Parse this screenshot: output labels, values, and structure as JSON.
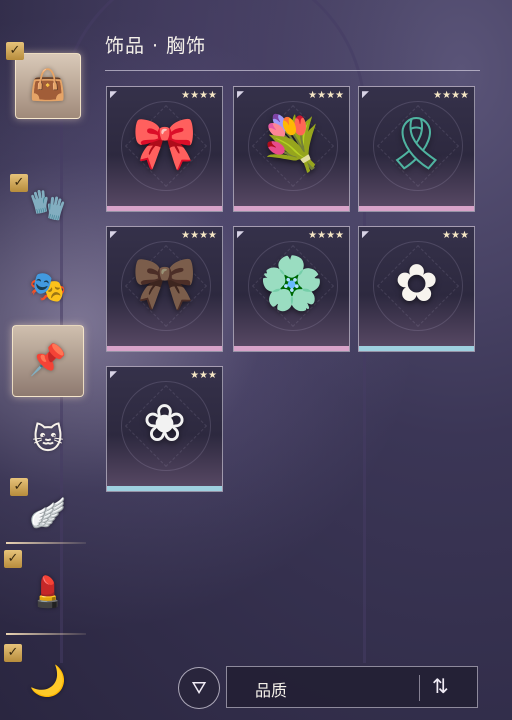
{
  "header": {
    "title": "饰品 · 胸饰"
  },
  "sidebar": {
    "items": [
      {
        "name": "bag-icon",
        "glyph": "👜"
      },
      {
        "name": "gloves-icon",
        "glyph": "🧤"
      },
      {
        "name": "mask-icon",
        "glyph": "🎭"
      },
      {
        "name": "brooch-pin-icon",
        "glyph": "📌"
      },
      {
        "name": "cat-ears-icon",
        "glyph": "🐱"
      },
      {
        "name": "wings-icon",
        "glyph": "🪽"
      },
      {
        "name": "makeup-icon",
        "glyph": "💄"
      },
      {
        "name": "accessory-icon",
        "glyph": "🌙"
      }
    ],
    "check": "✓"
  },
  "grid": {
    "items": [
      {
        "name": "gold-bow-brooch",
        "glyph": "🎀",
        "stars": "★★★★",
        "bar": "#d8a3c9"
      },
      {
        "name": "pink-flower-bouquet-brooch",
        "glyph": "💐",
        "stars": "★★★★",
        "bar": "#d8a3c9"
      },
      {
        "name": "green-ribbon-brooch",
        "glyph": "🎗",
        "stars": "★★★★",
        "bar": "#d8a3c9"
      },
      {
        "name": "brown-bow-brooch",
        "glyph": "🎀",
        "stars": "★★★★",
        "bar": "#d8a3c9"
      },
      {
        "name": "blue-flower-wreath-brooch",
        "glyph": "🌸",
        "stars": "★★★★",
        "bar": "#d8a3c9"
      },
      {
        "name": "white-lily-brooch",
        "glyph": "✿",
        "stars": "★★★",
        "bar": "#9fd0e0"
      },
      {
        "name": "white-flower-brooch",
        "glyph": "❀",
        "stars": "★★★",
        "bar": "#9fd0e0"
      }
    ],
    "corner": "◤"
  },
  "footer": {
    "filter_icon": "⛛",
    "sort_label": "品质",
    "sort_toggle": "⇅"
  }
}
